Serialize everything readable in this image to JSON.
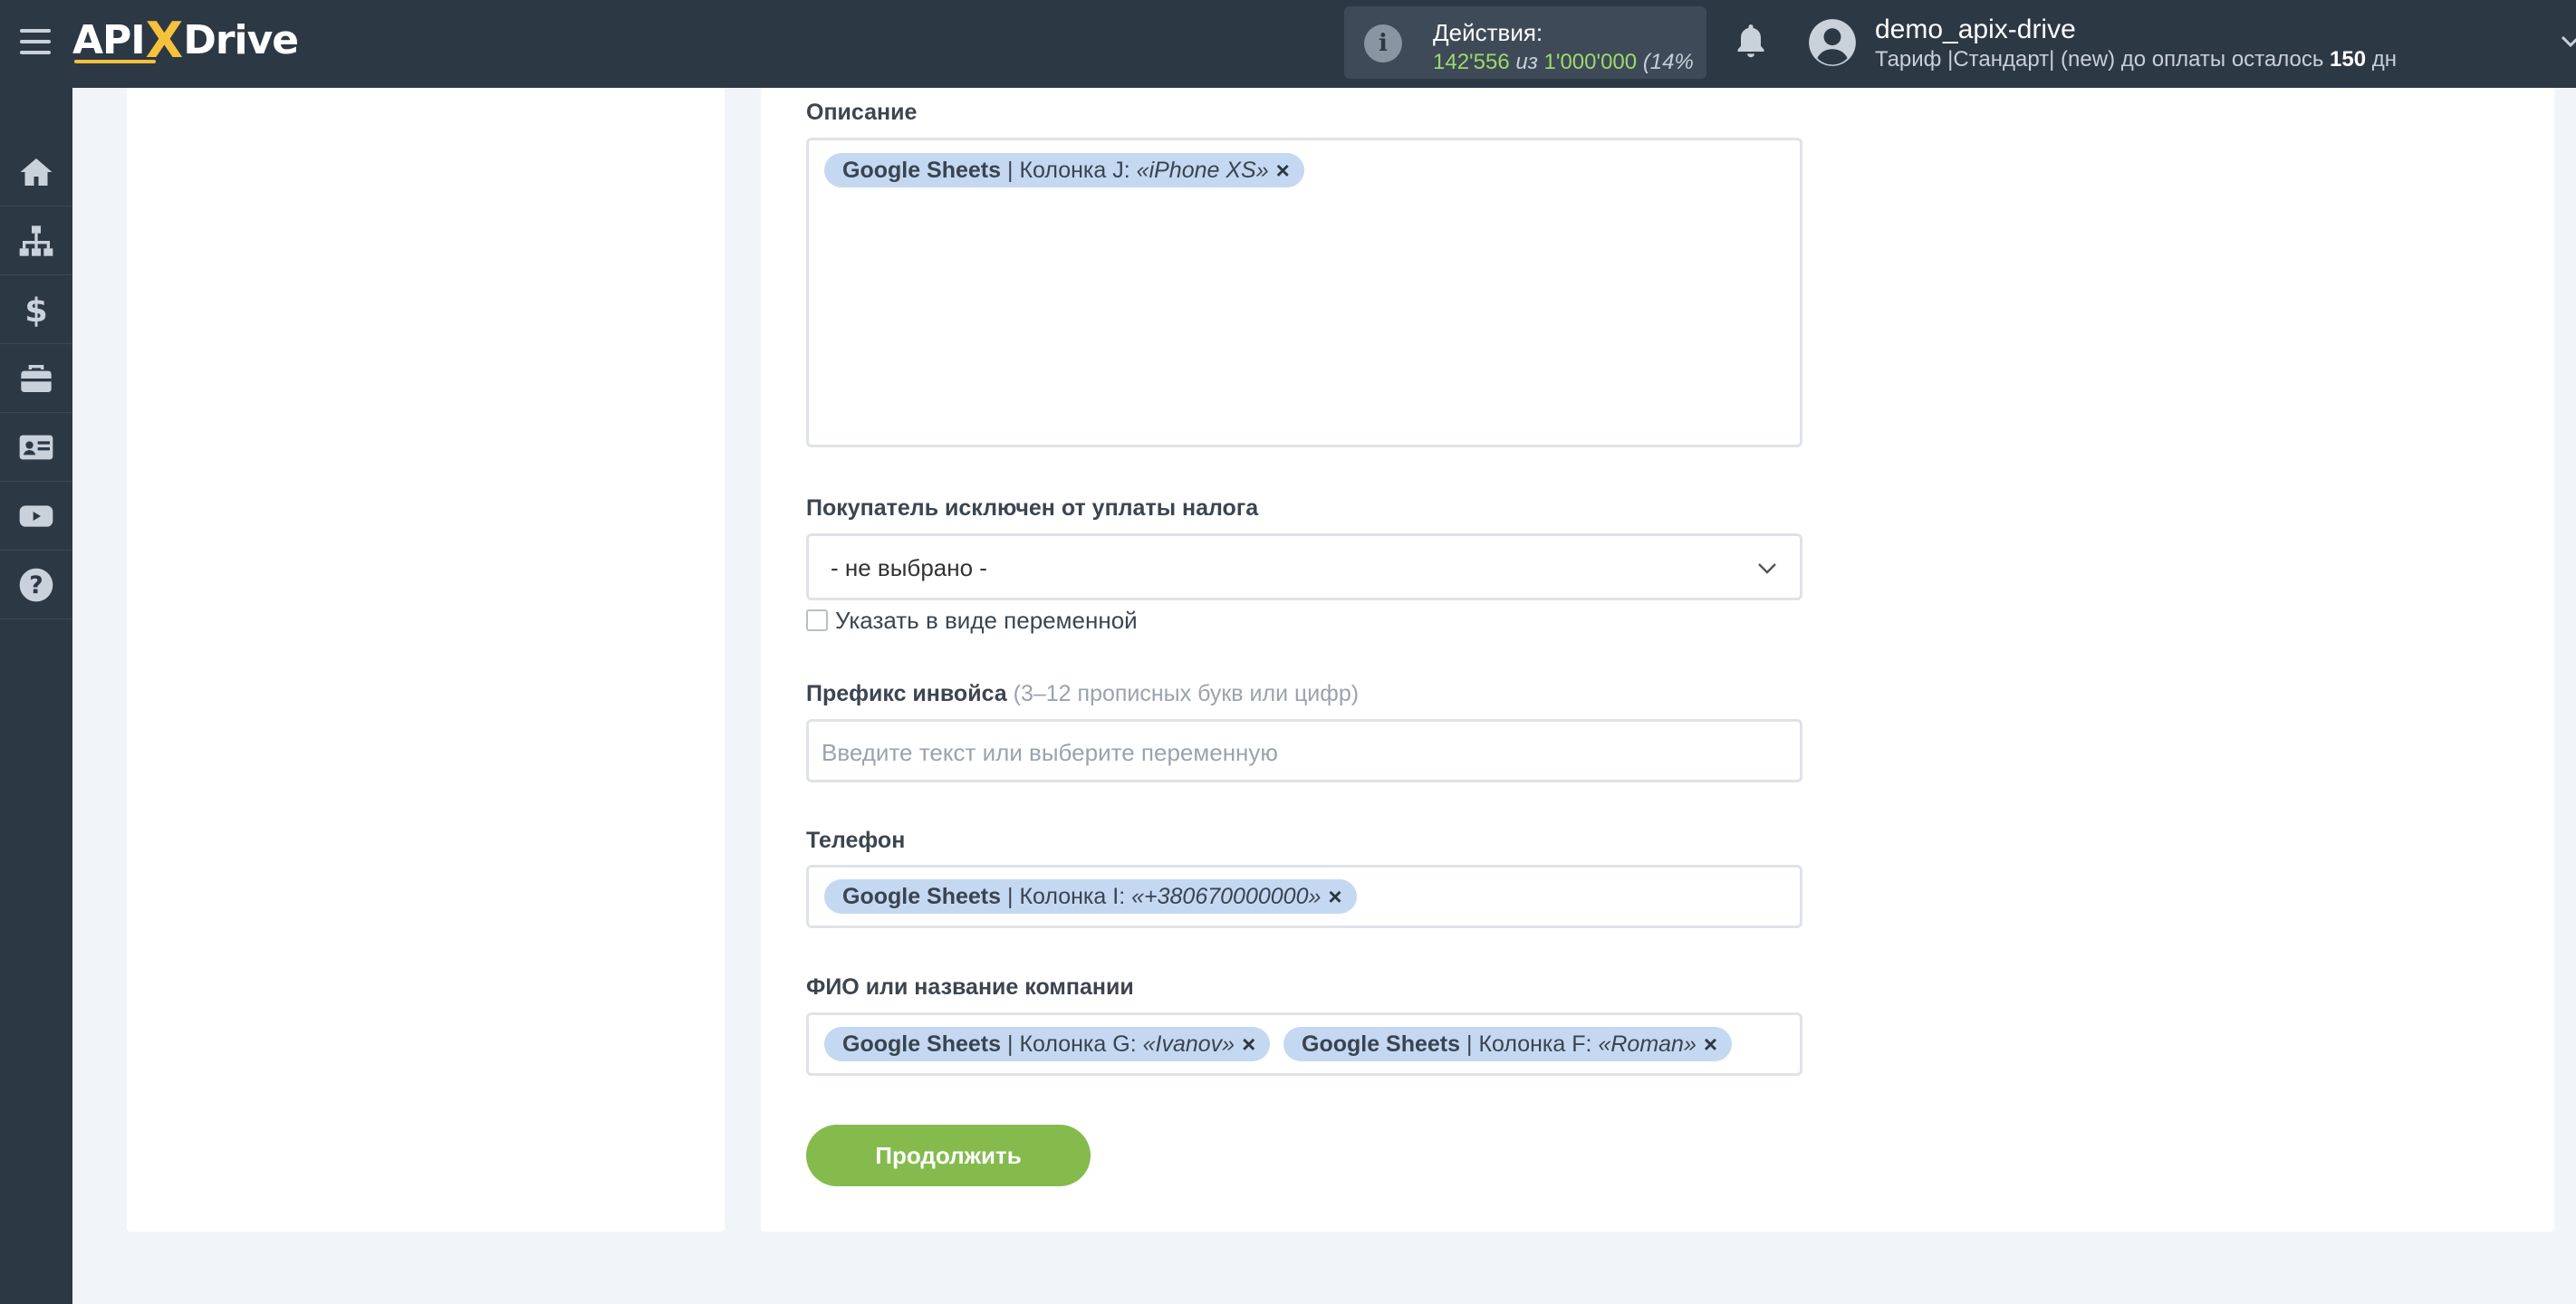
{
  "header": {
    "logo_api": "API",
    "logo_x": "X",
    "logo_drive": "Drive",
    "actions_title": "Действия:",
    "actions_used": "142'556",
    "actions_of": "из",
    "actions_limit": "1'000'000",
    "actions_pct": "(14%",
    "username": "demo_apix-drive",
    "tariff_text": "Тариф |Стандарт| (new) до оплаты осталось",
    "tariff_days": "150",
    "tariff_days_unit": "дн"
  },
  "sidebar": {
    "items": [
      {
        "icon": "home-icon"
      },
      {
        "icon": "sitemap-icon"
      },
      {
        "icon": "dollar-icon"
      },
      {
        "icon": "briefcase-icon"
      },
      {
        "icon": "id-card-icon"
      },
      {
        "icon": "youtube-icon"
      },
      {
        "icon": "help-icon"
      }
    ]
  },
  "form": {
    "description": {
      "label": "Описание",
      "tags": [
        {
          "source": "Google Sheets",
          "column": "| Колонка J:",
          "value": "«iPhone XS»"
        }
      ]
    },
    "tax_exempt": {
      "label": "Покупатель исключен от уплаты налога",
      "selected": "- не выбрано -",
      "checkbox_label": "Указать в виде переменной"
    },
    "invoice_prefix": {
      "label": "Префикс инвойса",
      "hint": "(3–12 прописных букв или цифр)",
      "placeholder": "Введите текст или выберите переменную"
    },
    "phone": {
      "label": "Телефон",
      "tags": [
        {
          "source": "Google Sheets",
          "column": "| Колонка I:",
          "value": "«+380670000000»"
        }
      ]
    },
    "fio": {
      "label": "ФИО или название компании",
      "tags": [
        {
          "source": "Google Sheets",
          "column": "| Колонка G:",
          "value": "«Ivanov»"
        },
        {
          "source": "Google Sheets",
          "column": "| Колонка F:",
          "value": "«Roman»"
        }
      ]
    },
    "continue_label": "Продолжить"
  },
  "colors": {
    "topbar": "#2d3845",
    "accent_green": "#84bb4c",
    "tag_bg": "#c4d8f1",
    "logo_yellow": "#f6c13b"
  }
}
